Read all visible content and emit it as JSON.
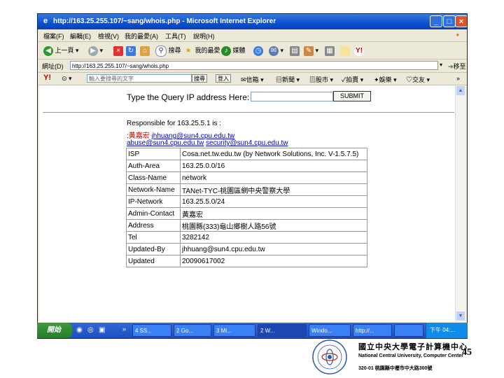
{
  "window": {
    "title": "http://163.25.255.107/~sang/whois.php - Microsoft Internet Explorer",
    "minimize": "_",
    "maximize": "□",
    "close": "×"
  },
  "menubar": {
    "items": [
      "檔案(F)",
      "編輯(E)",
      "檢視(V)",
      "我的最愛(A)",
      "工具(T)",
      "說明(H)"
    ]
  },
  "toolbar": {
    "back": "上一頁",
    "search": "搜尋",
    "favorites": "我的最愛",
    "media": "媒體"
  },
  "address": {
    "label": "網址(D)",
    "url": "http://163.25.255.107/~sang/whois.php",
    "go": "移至"
  },
  "yahoo": {
    "logo": "Y!",
    "search_placeholder": "輸入要搜尋的文字",
    "search_button": "搜尋",
    "login_button": "登入",
    "items": [
      "信箱",
      "新聞",
      "股市",
      "拍賣",
      "娛樂",
      "交友"
    ]
  },
  "page": {
    "query_label": "Type the Query IP address Here:",
    "submit_label": "SUBMIT",
    "responsible_label": "Responsible for 163.25.5.1 is :",
    "contact_name": "黃嘉宏",
    "contact_email": "jhhuang@sun4.cpu.edu.tw",
    "abuse_email": "abuse@sun4.cpu.edu.tw",
    "security_email": "security@sun4.cpu.edu.tw",
    "table": [
      {
        "key": "ISP",
        "value": "Cosa.net.tw.edu.tw (by Network Solutions, Inc. V-1.5.7.5)"
      },
      {
        "key": "Auth-Area",
        "value": "163.25.0.0/16"
      },
      {
        "key": "Class-Name",
        "value": "network"
      },
      {
        "key": "Network-Name",
        "value": "TANet-TYC-桃園區網中央警察大學"
      },
      {
        "key": "IP-Network",
        "value": "163.25.5.0/24"
      },
      {
        "key": "Admin-Contact",
        "value": "黃嘉宏"
      },
      {
        "key": "Address",
        "value": "桃園縣(333)龜山鄉樹人路56號"
      },
      {
        "key": "Tel",
        "value": "3282142"
      },
      {
        "key": "Updated-By",
        "value": "jhhuang@sun4.cpu.edu.tw"
      },
      {
        "key": "Updated",
        "value": "20090617002"
      }
    ]
  },
  "taskbar": {
    "start": "開始",
    "tasks": [
      "4 SS...",
      "2 Go...",
      "3 Mi...",
      "2 W...",
      "Windo...",
      "http://...",
      ""
    ],
    "tray_time": "下午 04:..."
  },
  "branding": {
    "cn_name": "國立中央大學電子計算機中心",
    "en_name": "National Central University, Computer Center",
    "address": "320-01 桃園縣中壢市中大路300號",
    "page_number": "45",
    "logo_text": "NATIONAL CENTRAL UNIVERSITY · COMPUTER CENTER"
  }
}
